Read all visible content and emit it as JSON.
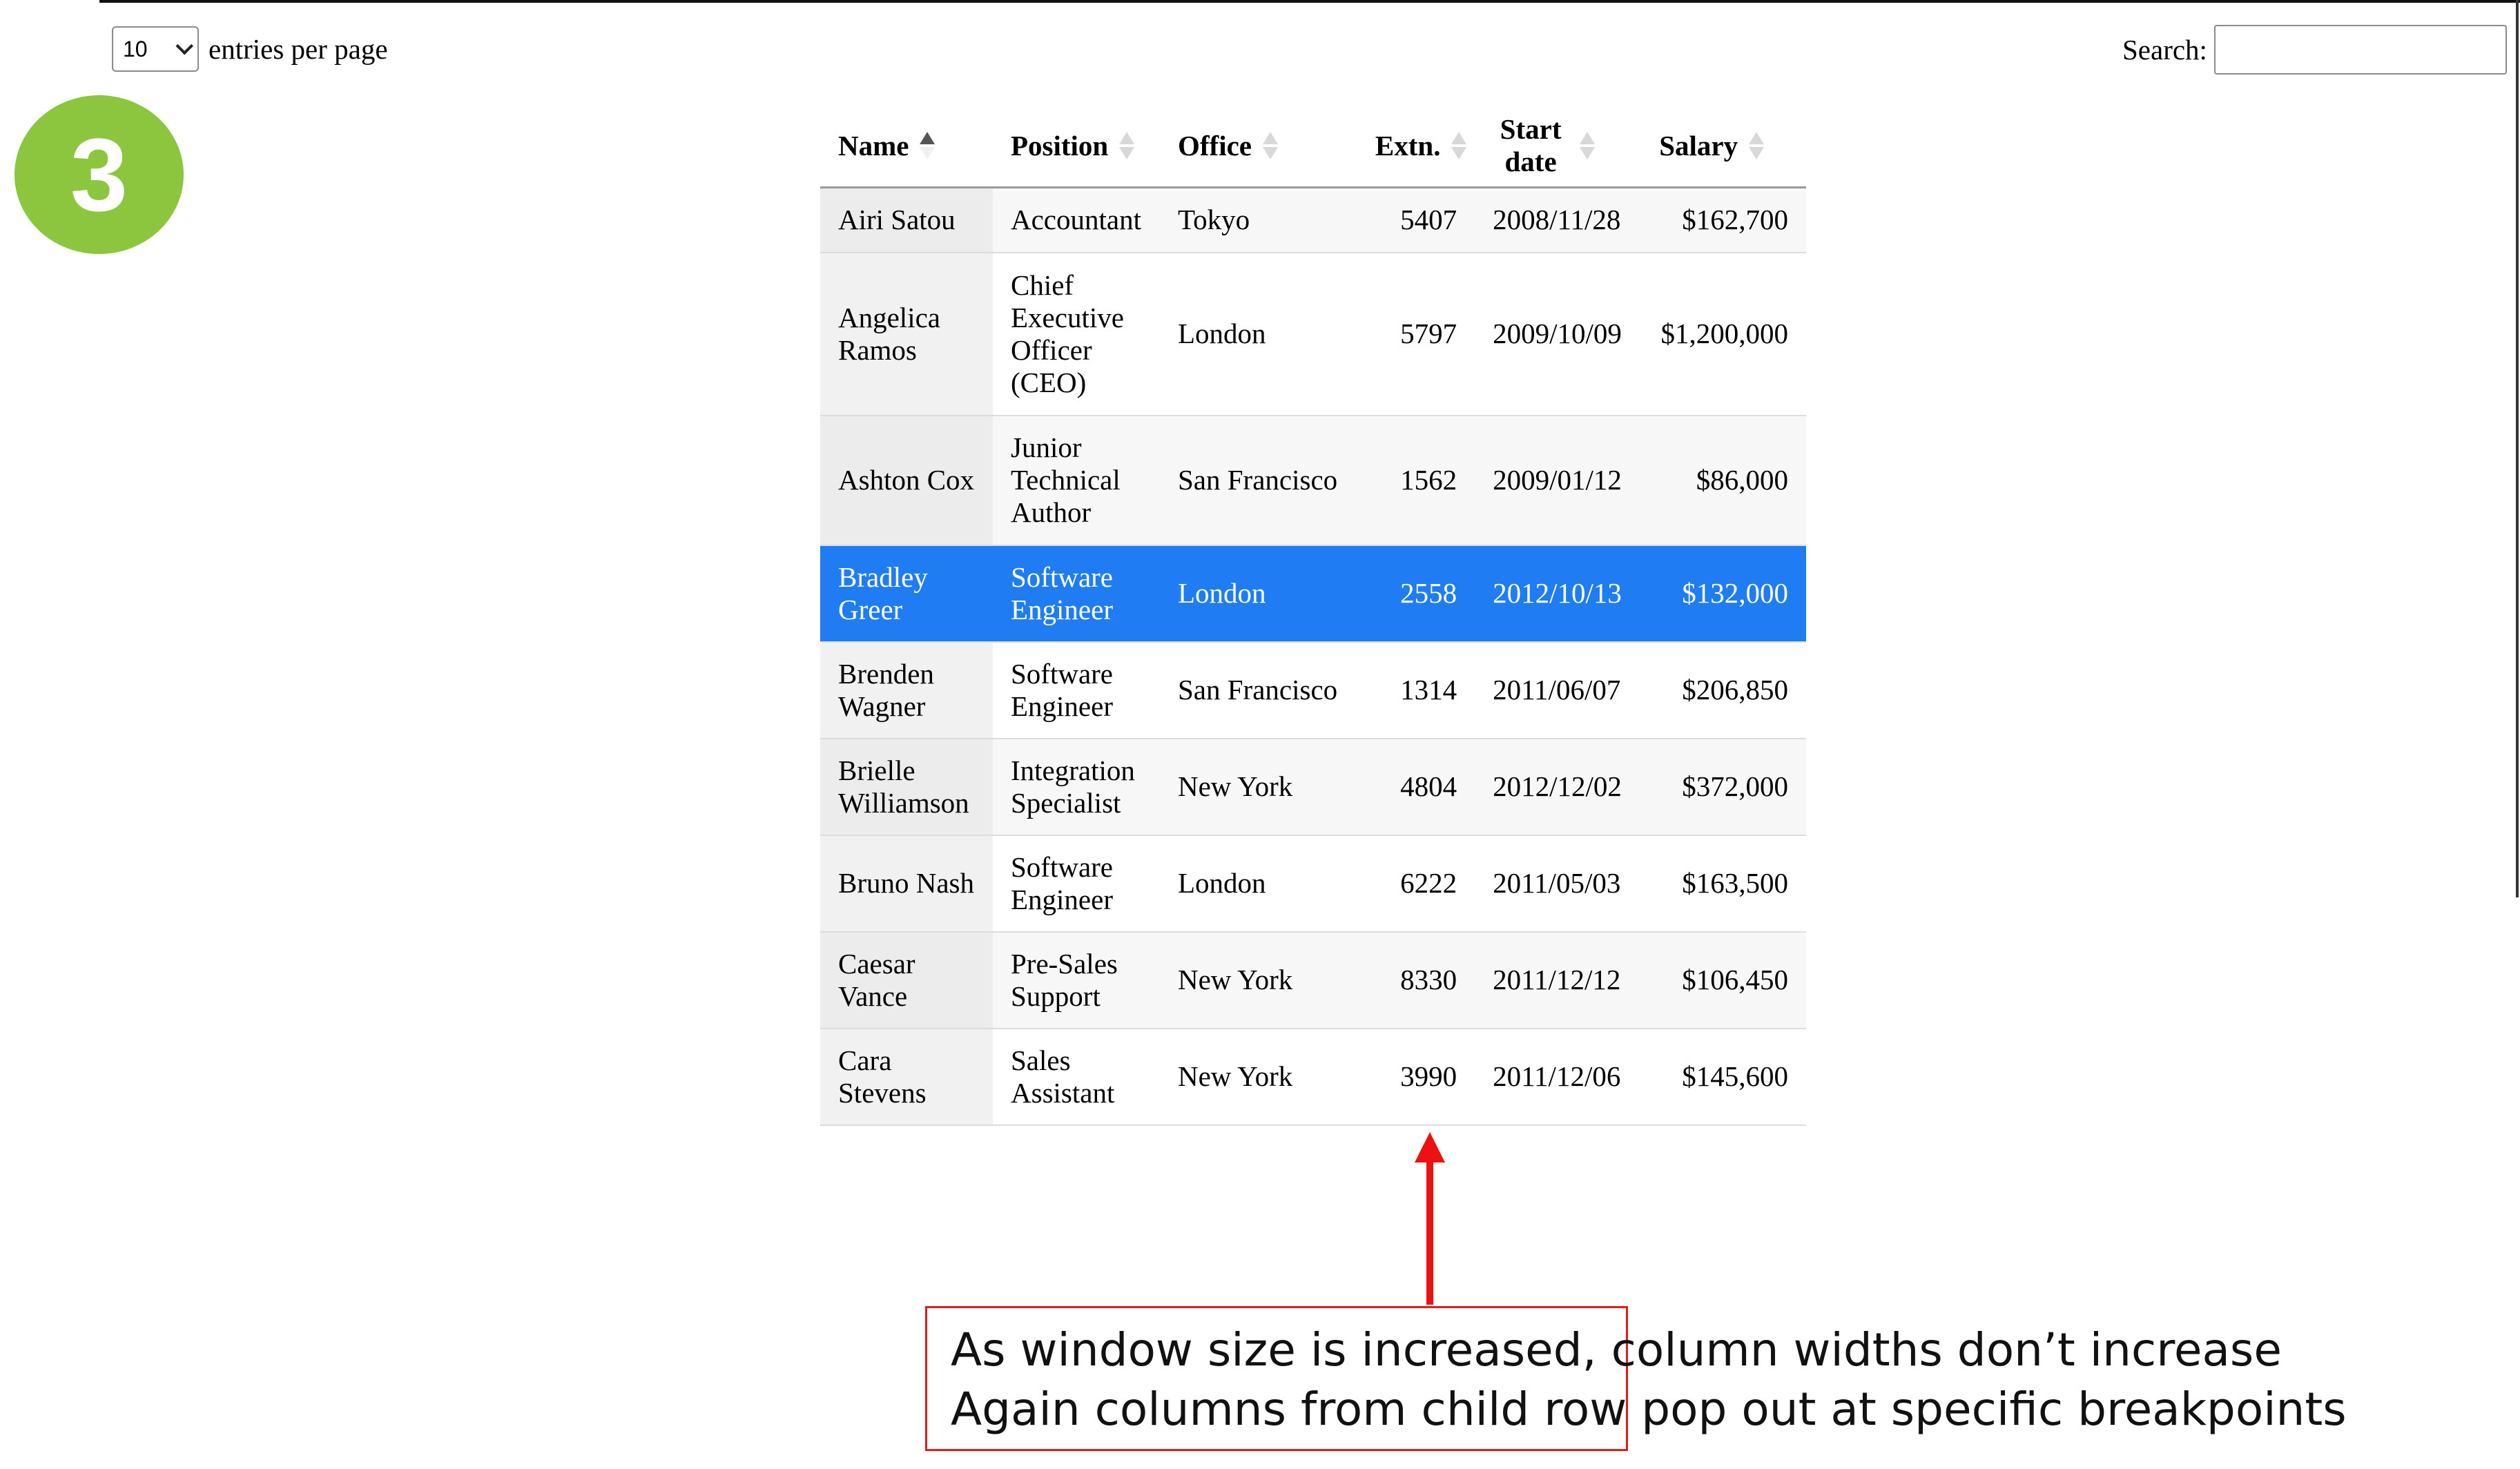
{
  "step_badge": "3",
  "length_control": {
    "selected": "10",
    "label": "entries per page"
  },
  "search": {
    "label": "Search:",
    "value": "",
    "placeholder": ""
  },
  "table": {
    "columns": [
      {
        "label": "Name",
        "sort": "ascending"
      },
      {
        "label": "Position",
        "sort": "none"
      },
      {
        "label": "Office",
        "sort": "none"
      },
      {
        "label": "Extn.",
        "sort": "none"
      },
      {
        "label": "Start date",
        "sort": "none"
      },
      {
        "label": "Salary",
        "sort": "none"
      }
    ],
    "rows": [
      {
        "name": "Airi Satou",
        "position": "Accountant",
        "office": "Tokyo",
        "extn": "5407",
        "start_date": "2008/11/28",
        "salary": "$162,700",
        "selected": false
      },
      {
        "name": "Angelica Ramos",
        "position": "Chief Executive Officer (CEO)",
        "office": "London",
        "extn": "5797",
        "start_date": "2009/10/09",
        "salary": "$1,200,000",
        "selected": false
      },
      {
        "name": "Ashton Cox",
        "position": "Junior Technical Author",
        "office": "San Francisco",
        "extn": "1562",
        "start_date": "2009/01/12",
        "salary": "$86,000",
        "selected": false
      },
      {
        "name": "Bradley Greer",
        "position": "Software Engineer",
        "office": "London",
        "extn": "2558",
        "start_date": "2012/10/13",
        "salary": "$132,000",
        "selected": true
      },
      {
        "name": "Brenden Wagner",
        "position": "Software Engineer",
        "office": "San Francisco",
        "extn": "1314",
        "start_date": "2011/06/07",
        "salary": "$206,850",
        "selected": false
      },
      {
        "name": "Brielle Williamson",
        "position": "Integration Specialist",
        "office": "New York",
        "extn": "4804",
        "start_date": "2012/12/02",
        "salary": "$372,000",
        "selected": false
      },
      {
        "name": "Bruno Nash",
        "position": "Software Engineer",
        "office": "London",
        "extn": "6222",
        "start_date": "2011/05/03",
        "salary": "$163,500",
        "selected": false
      },
      {
        "name": "Caesar Vance",
        "position": "Pre-Sales Support",
        "office": "New York",
        "extn": "8330",
        "start_date": "2011/12/12",
        "salary": "$106,450",
        "selected": false
      },
      {
        "name": "Cara Stevens",
        "position": "Sales Assistant",
        "office": "New York",
        "extn": "3990",
        "start_date": "2011/12/06",
        "salary": "$145,600",
        "selected": false
      }
    ]
  },
  "annotation": {
    "line1": "As window size is increased, column widths don’t increase",
    "line2": "Again columns from child row pop out at specific breakpoints"
  },
  "colors": {
    "badge": "#8cc63f",
    "selected_row": "#1f7cf2",
    "annotation": "#e21b1b"
  }
}
